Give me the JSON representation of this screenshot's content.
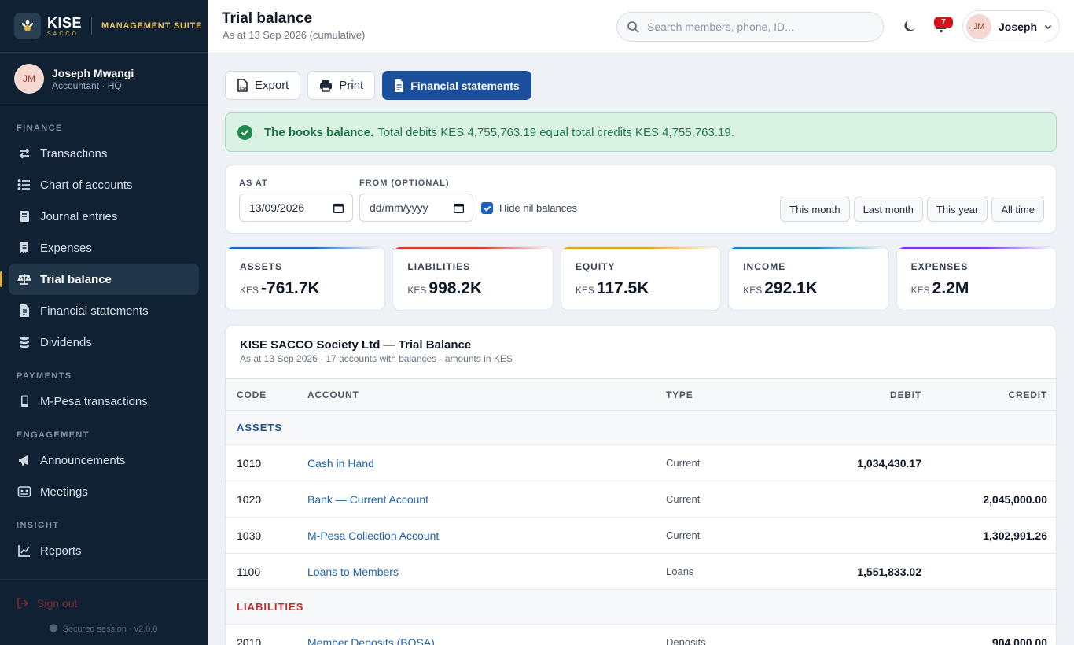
{
  "brand": {
    "name": "KISE",
    "sub": "SACCO",
    "suite": "MANAGEMENT SUITE"
  },
  "profile": {
    "initials": "JM",
    "name": "Joseph Mwangi",
    "role": "Accountant · HQ"
  },
  "nav": {
    "finance_label": "FINANCE",
    "finance": [
      {
        "label": "Transactions",
        "icon": "arrows-icon"
      },
      {
        "label": "Chart of accounts",
        "icon": "list-icon"
      },
      {
        "label": "Journal entries",
        "icon": "book-icon"
      },
      {
        "label": "Expenses",
        "icon": "receipt-icon"
      },
      {
        "label": "Trial balance",
        "icon": "scale-icon",
        "active": true
      },
      {
        "label": "Financial statements",
        "icon": "document-icon"
      },
      {
        "label": "Dividends",
        "icon": "coins-icon"
      }
    ],
    "payments_label": "PAYMENTS",
    "payments": [
      {
        "label": "M-Pesa transactions",
        "icon": "phone-icon"
      }
    ],
    "engagement_label": "ENGAGEMENT",
    "engagement": [
      {
        "label": "Announcements",
        "icon": "megaphone-icon"
      },
      {
        "label": "Meetings",
        "icon": "meeting-icon"
      }
    ],
    "insight_label": "INSIGHT",
    "insight": [
      {
        "label": "Reports",
        "icon": "chart-icon"
      }
    ],
    "signout": "Sign out",
    "secure": "Secured session · v2.0.0"
  },
  "header": {
    "title": "Trial balance",
    "subtitle": "As at 13 Sep 2026 (cumulative)",
    "search_placeholder": "Search members, phone, ID...",
    "notifications": "7",
    "user_initials": "JM",
    "user_name": "Joseph"
  },
  "actions": {
    "export": "Export",
    "print": "Print",
    "statements": "Financial statements"
  },
  "alert": {
    "strong": "The books balance.",
    "text": "Total debits KES 4,755,763.19 equal total credits KES 4,755,763.19."
  },
  "filters": {
    "as_at_label": "AS AT",
    "as_at_value": "13/09/2026",
    "from_label": "FROM (OPTIONAL)",
    "from_value": "dd/mm/yyyy",
    "hide_nil": "Hide nil balances",
    "hide_nil_checked": true,
    "presets": [
      "This month",
      "Last month",
      "This year",
      "All time"
    ]
  },
  "cards": [
    {
      "label": "ASSETS",
      "currency": "KES",
      "value": "-761.7K",
      "accent": "#2563c9"
    },
    {
      "label": "LIABILITIES",
      "currency": "KES",
      "value": "998.2K",
      "accent": "#d23b3b"
    },
    {
      "label": "EQUITY",
      "currency": "KES",
      "value": "117.5K",
      "accent": "#e0a52c"
    },
    {
      "label": "INCOME",
      "currency": "KES",
      "value": "292.1K",
      "accent": "#1e88b4"
    },
    {
      "label": "EXPENSES",
      "currency": "KES",
      "value": "2.2M",
      "accent": "#7c3aed"
    }
  ],
  "table": {
    "title": "KISE SACCO Society Ltd — Trial Balance",
    "subtitle": "As at 13 Sep 2026 · 17 accounts with balances · amounts in KES",
    "headers": {
      "code": "CODE",
      "account": "ACCOUNT",
      "type": "TYPE",
      "debit": "DEBIT",
      "credit": "CREDIT"
    },
    "groups": [
      {
        "name": "ASSETS",
        "color": "#1d4f91",
        "rows": [
          {
            "code": "1010",
            "account": "Cash in Hand",
            "type": "Current",
            "debit": "1,034,430.17",
            "credit": ""
          },
          {
            "code": "1020",
            "account": "Bank — Current Account",
            "type": "Current",
            "debit": "",
            "credit": "2,045,000.00"
          },
          {
            "code": "1030",
            "account": "M-Pesa Collection Account",
            "type": "Current",
            "debit": "",
            "credit": "1,302,991.26"
          },
          {
            "code": "1100",
            "account": "Loans to Members",
            "type": "Loans",
            "debit": "1,551,833.02",
            "credit": ""
          }
        ]
      },
      {
        "name": "LIABILITIES",
        "color": "#c62828",
        "rows": [
          {
            "code": "2010",
            "account": "Member Deposits (BOSA)",
            "type": "Deposits",
            "debit": "",
            "credit": "904,000.00"
          }
        ]
      }
    ]
  }
}
